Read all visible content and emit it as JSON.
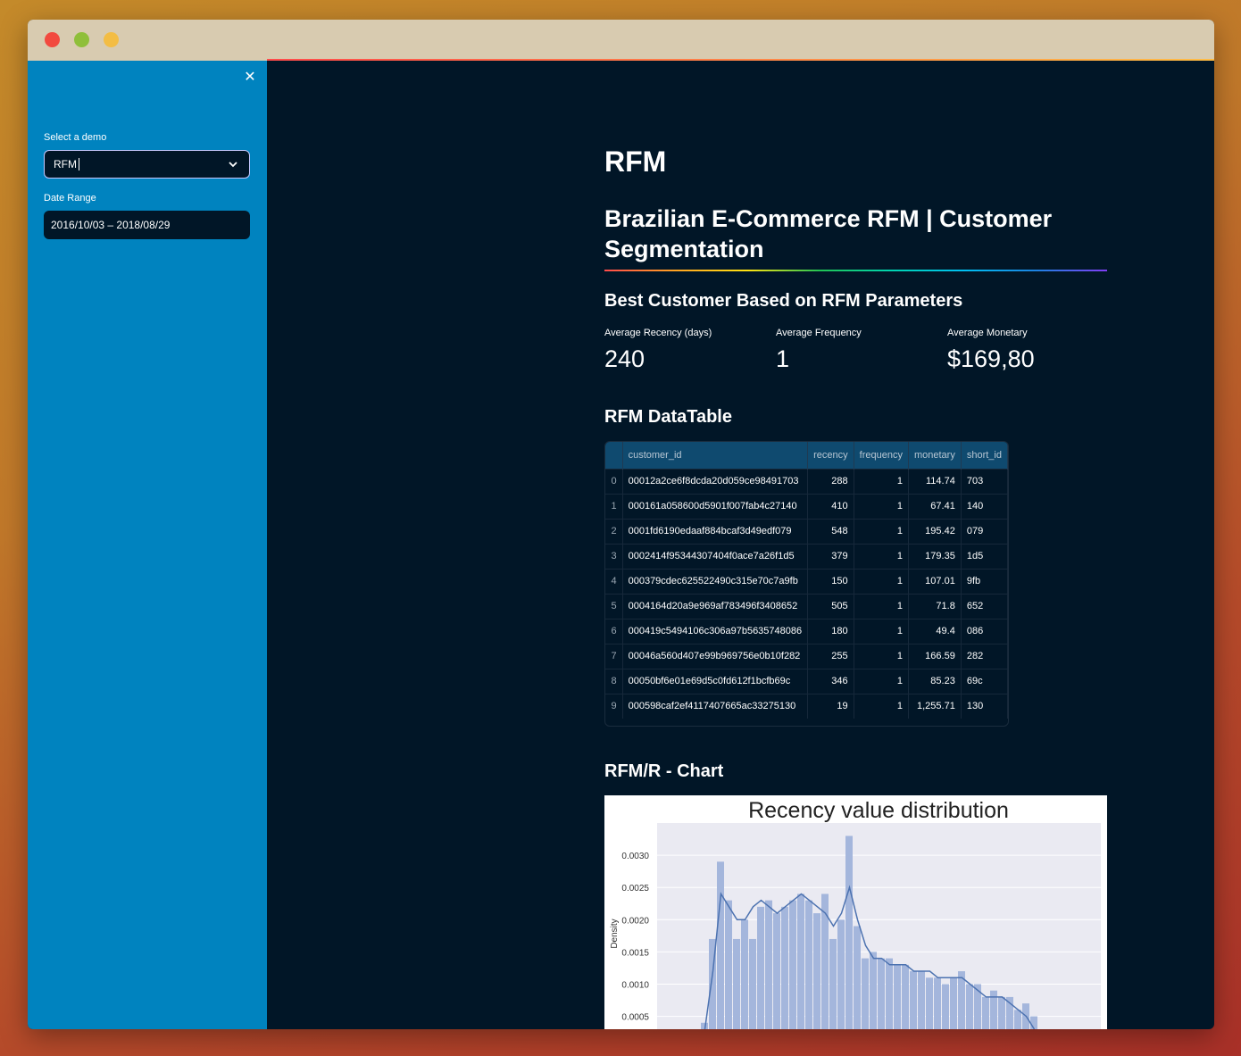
{
  "sidebar": {
    "close_glyph": "✕",
    "select_label": "Select a demo",
    "select_value": "RFM",
    "date_label": "Date Range",
    "date_value": "2016/10/03 – 2018/08/29"
  },
  "main": {
    "title": "RFM",
    "subtitle": "Brazilian E-Commerce RFM | Customer Segmentation",
    "best_heading": "Best Customer Based on RFM Parameters",
    "metrics": [
      {
        "label": "Average Recency (days)",
        "value": "240"
      },
      {
        "label": "Average Frequency",
        "value": "1"
      },
      {
        "label": "Average Monetary",
        "value": "$169,80"
      }
    ],
    "table_heading": "RFM DataTable",
    "chart_heading": "RFM/R - Chart"
  },
  "table": {
    "columns": [
      "",
      "customer_id",
      "recency",
      "frequency",
      "monetary",
      "short_id"
    ],
    "rows": [
      [
        "0",
        "00012a2ce6f8dcda20d059ce98491703",
        "288",
        "1",
        "114.74",
        "703"
      ],
      [
        "1",
        "000161a058600d5901f007fab4c27140",
        "410",
        "1",
        "67.41",
        "140"
      ],
      [
        "2",
        "0001fd6190edaaf884bcaf3d49edf079",
        "548",
        "1",
        "195.42",
        "079"
      ],
      [
        "3",
        "0002414f95344307404f0ace7a26f1d5",
        "379",
        "1",
        "179.35",
        "1d5"
      ],
      [
        "4",
        "000379cdec625522490c315e70c7a9fb",
        "150",
        "1",
        "107.01",
        "9fb"
      ],
      [
        "5",
        "0004164d20a9e969af783496f3408652",
        "505",
        "1",
        "71.8",
        "652"
      ],
      [
        "6",
        "000419c5494106c306a97b5635748086",
        "180",
        "1",
        "49.4",
        "086"
      ],
      [
        "7",
        "00046a560d407e99b969756e0b10f282",
        "255",
        "1",
        "166.59",
        "282"
      ],
      [
        "8",
        "00050bf6e01e69d5c0fd612f1bcfb69c",
        "346",
        "1",
        "85.23",
        "69c"
      ],
      [
        "9",
        "000598caf2ef4117407665ac33275130",
        "19",
        "1",
        "1,255.71",
        "130"
      ]
    ]
  },
  "chart_data": {
    "type": "bar",
    "title": "Recency value distribution",
    "ylabel": "Density",
    "xlabel": "",
    "ylim": [
      0.0003,
      0.0035
    ],
    "yticks": [
      "0.0030",
      "0.0025",
      "0.0020",
      "0.0015",
      "0.0010",
      "0.0005"
    ],
    "ytick_values": [
      0.003,
      0.0025,
      0.002,
      0.0015,
      0.001,
      0.0005
    ],
    "values": [
      0.0004,
      0.0017,
      0.0029,
      0.0023,
      0.0017,
      0.002,
      0.0017,
      0.0022,
      0.0023,
      0.0021,
      0.0022,
      0.0023,
      0.0024,
      0.0023,
      0.0021,
      0.0024,
      0.0017,
      0.002,
      0.0033,
      0.0019,
      0.0014,
      0.0015,
      0.0014,
      0.0014,
      0.0013,
      0.0013,
      0.0012,
      0.0012,
      0.0011,
      0.0011,
      0.001,
      0.0011,
      0.0012,
      0.001,
      0.001,
      0.0008,
      0.0009,
      0.0008,
      0.0008,
      0.0006,
      0.0007,
      0.0005
    ],
    "kde": [
      0.0003,
      0.0012,
      0.0024,
      0.0022,
      0.002,
      0.002,
      0.0022,
      0.0023,
      0.0022,
      0.0021,
      0.0022,
      0.0023,
      0.0024,
      0.0023,
      0.0022,
      0.0021,
      0.0019,
      0.0021,
      0.0025,
      0.002,
      0.0016,
      0.0014,
      0.0014,
      0.0013,
      0.0013,
      0.0013,
      0.0012,
      0.0012,
      0.0012,
      0.0011,
      0.0011,
      0.0011,
      0.0011,
      0.001,
      0.0009,
      0.0008,
      0.0008,
      0.0008,
      0.0007,
      0.0006,
      0.0005,
      0.0003
    ],
    "grid": true,
    "colors": {
      "bars": "#a4b6dc",
      "kde": "#4c72b0",
      "plot_bg": "#eaeaf2"
    }
  }
}
